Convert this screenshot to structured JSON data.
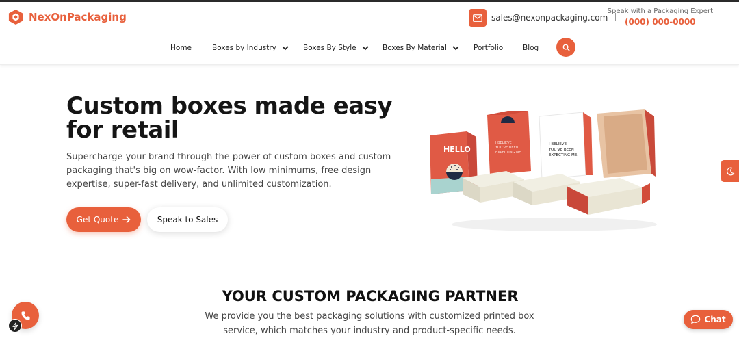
{
  "brand": {
    "name": "NexOnPackaging"
  },
  "contact": {
    "email": "sales@nexonpackaging.com",
    "speak_label": "Speak with a Packaging Expert",
    "phone": "(000) 000-0000"
  },
  "nav": {
    "items": [
      {
        "label": "Home",
        "dropdown": false
      },
      {
        "label": "Boxes by Industry",
        "dropdown": true
      },
      {
        "label": "Boxes By Style",
        "dropdown": true
      },
      {
        "label": "Boxes By Material",
        "dropdown": true
      },
      {
        "label": "Portfolio",
        "dropdown": false
      },
      {
        "label": "Blog",
        "dropdown": false
      }
    ]
  },
  "hero": {
    "title": "Custom boxes made easy for retail",
    "description": "Supercharge your brand through the power of custom boxes and custom packaging that's big on wow-factor. With low minimums, free design expertise, super-fast delivery, and unlimited customization.",
    "primary_cta": "Get Quote",
    "secondary_cta": "Speak to Sales",
    "image_text": {
      "hello": "HELLO",
      "box_text": "I BELIEVE YOU'VE BEEN EXPECTING ME."
    }
  },
  "section": {
    "title": "YOUR CUSTOM PACKAGING PARTNER",
    "description": "We provide you the best packaging solutions with customized printed box service, which matches your industry and product-specific needs."
  },
  "widgets": {
    "chat_label": "Chat"
  },
  "colors": {
    "accent": "#e8603c",
    "text": "#151515",
    "muted": "#444444"
  },
  "icons": [
    "hexagon-logo-icon",
    "mail-icon",
    "search-icon",
    "chevron-down-icon",
    "arrow-right-icon",
    "moon-icon",
    "phone-icon",
    "bolt-icon",
    "chat-bubble-icon"
  ]
}
